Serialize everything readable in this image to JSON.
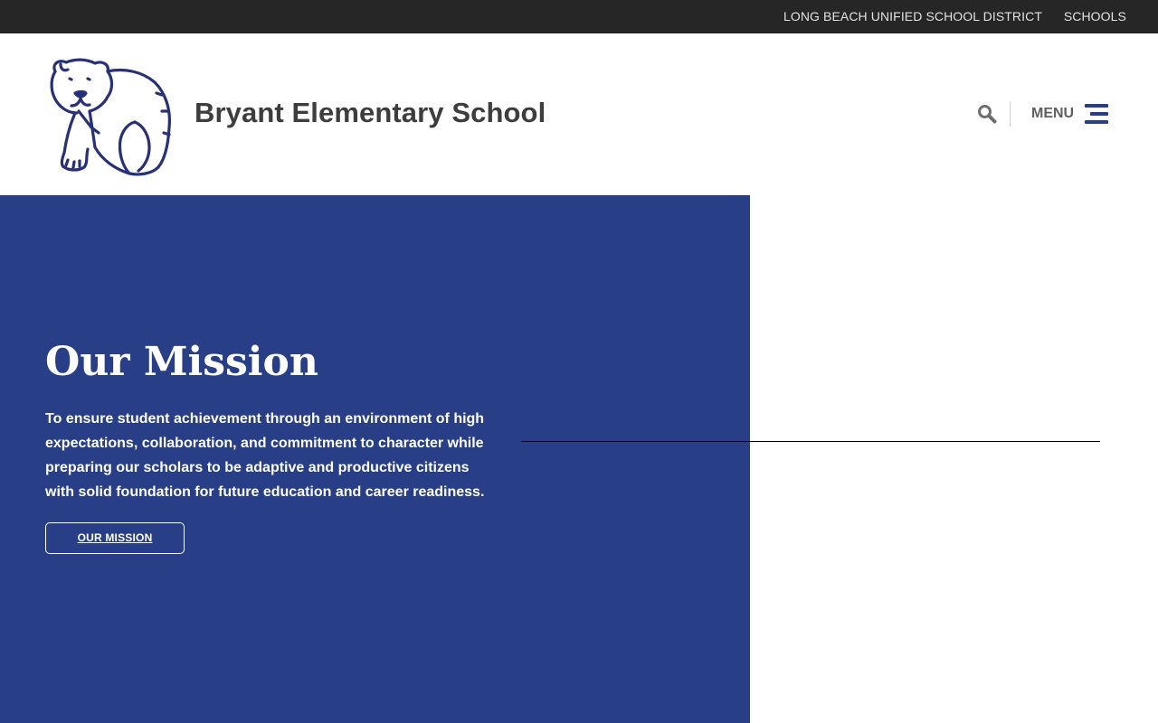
{
  "utility_bar": {
    "district_link": "LONG BEACH UNIFIED SCHOOL DISTRICT",
    "schools_link": "SCHOOLS"
  },
  "header": {
    "logo_icon": "polar-bear-mascot",
    "site_title": "Bryant Elementary School",
    "search_icon": "magnifier-icon",
    "menu_label": "MENU",
    "menu_icon": "hamburger-icon"
  },
  "mission": {
    "heading": "Our Mission",
    "text": "To ensure student achievement through an environment of high expectations, collaboration, and commitment to character while preparing our scholars to be adaptive and productive citizens with solid foundation for future education and career readiness.",
    "button_label": "OUR MISSION"
  },
  "colors": {
    "utility_bar_bg": "#262626",
    "brand_blue": "#283f88",
    "title_text": "#3d3d3d",
    "menu_text": "#5f5f5f"
  }
}
